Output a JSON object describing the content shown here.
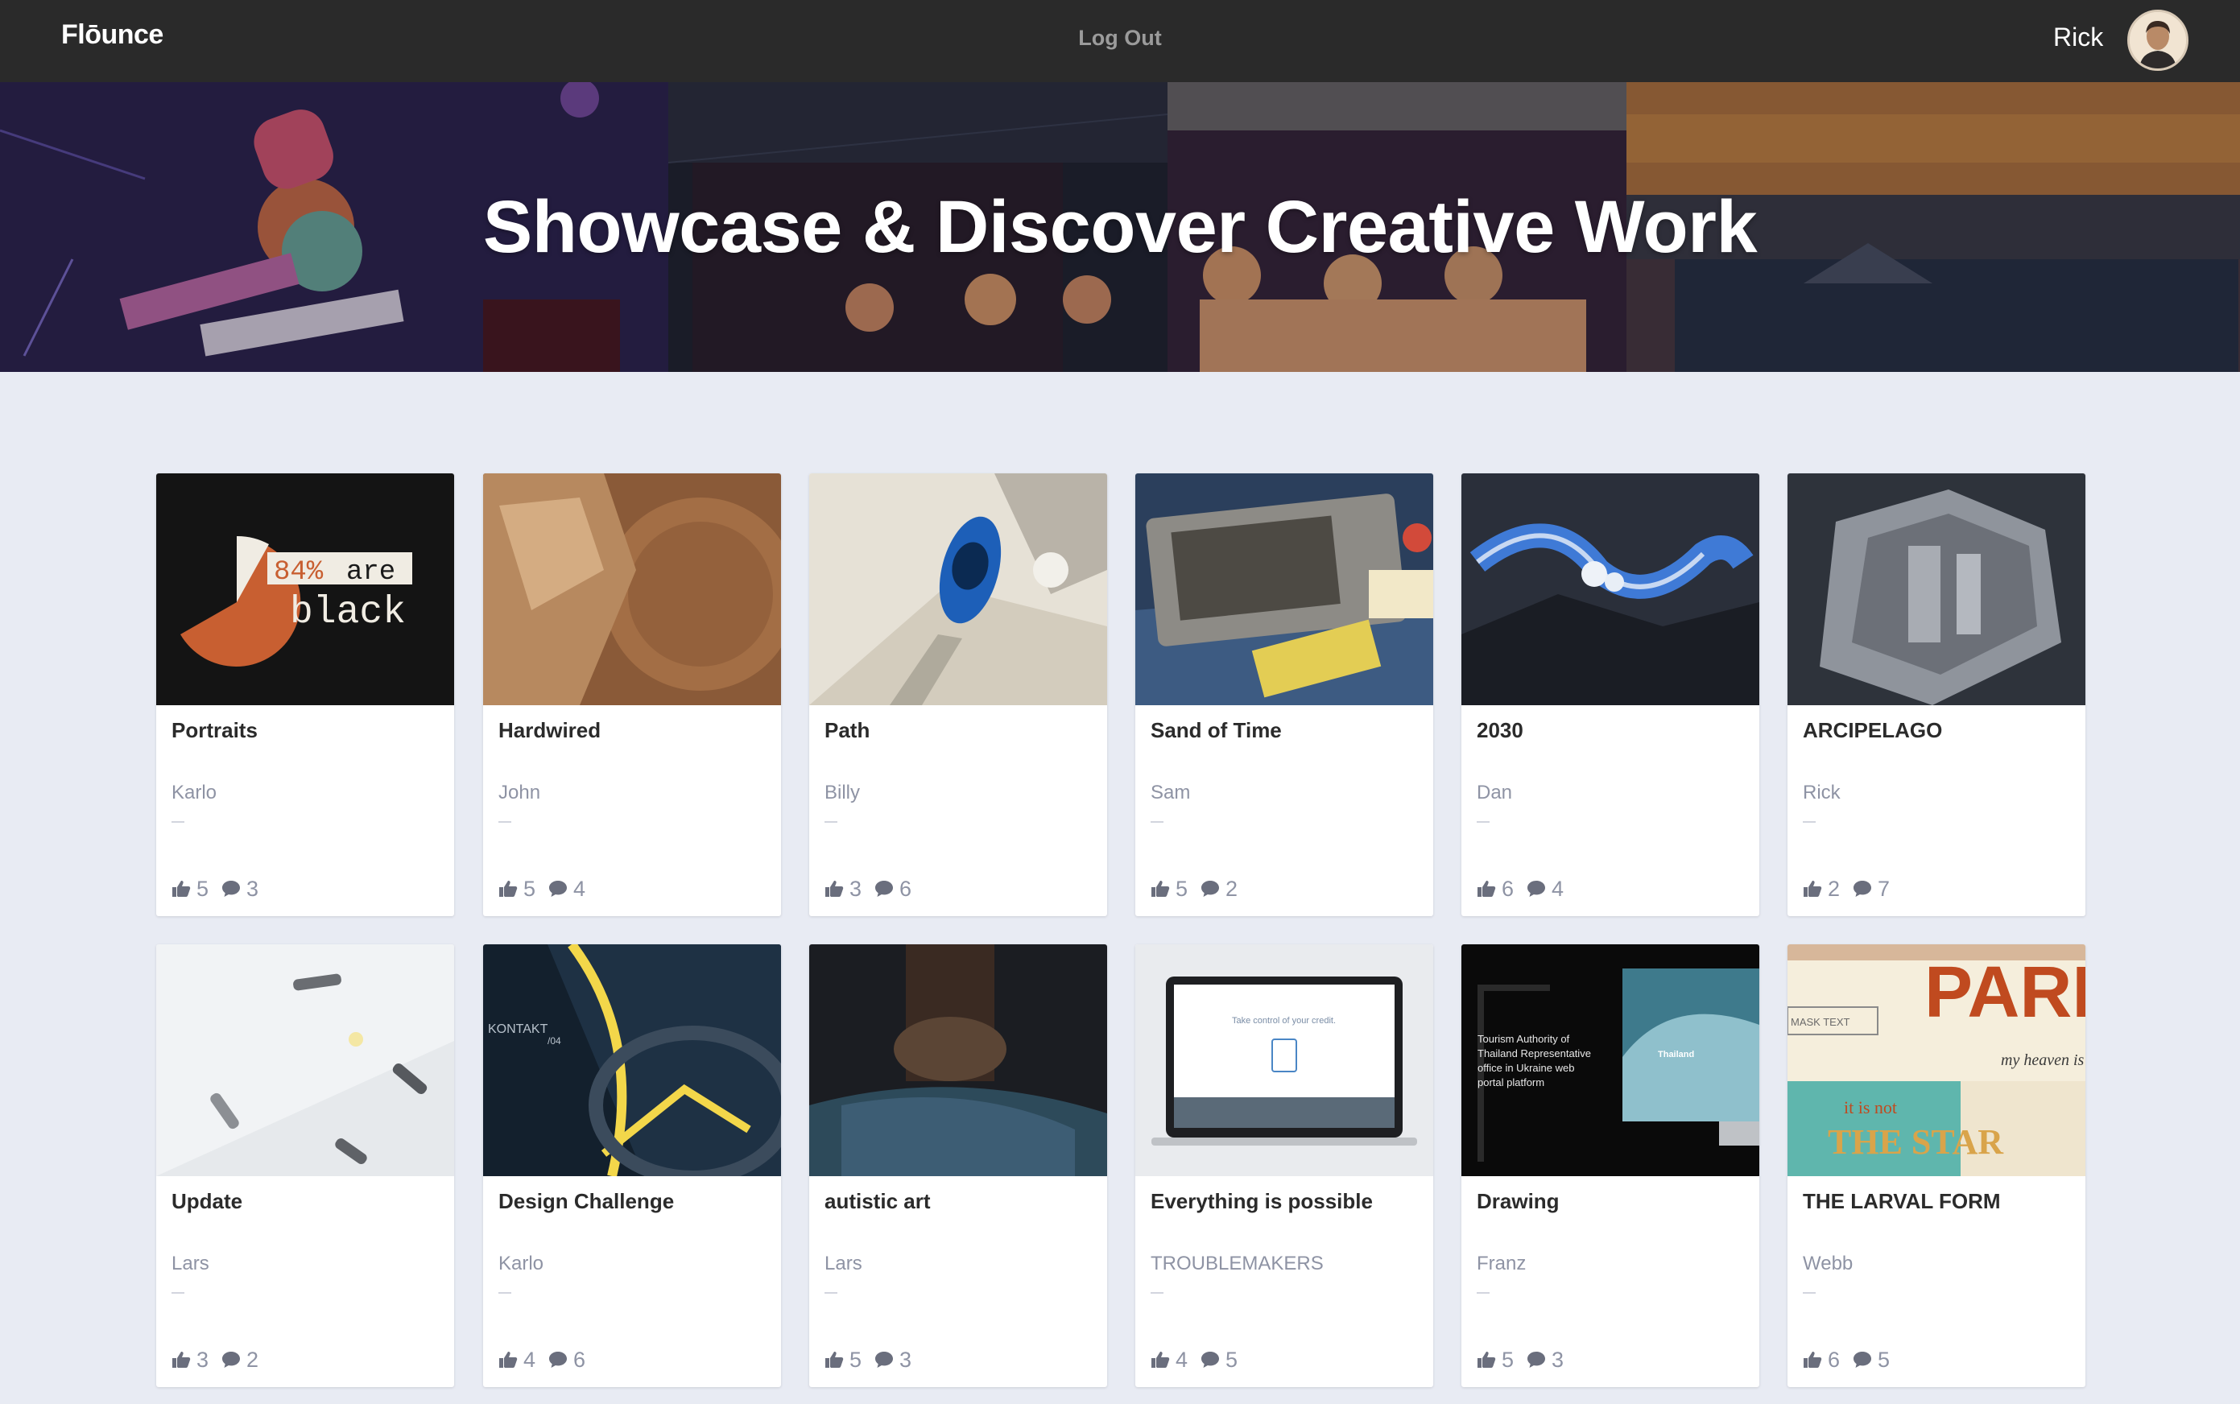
{
  "nav": {
    "logo": "Flōunce",
    "logout_label": "Log Out",
    "username": "Rick"
  },
  "hero": {
    "title": "Showcase & Discover Creative Work"
  },
  "colors": {
    "nav_bg": "#2a2a2a",
    "page_bg": "#e8ebf3",
    "card_bg": "#ffffff",
    "muted_text": "#8e93a4"
  },
  "projects": [
    {
      "title": "Portraits",
      "author": "Karlo",
      "likes": "5",
      "comments": "3",
      "thumb_text_1": "84%",
      "thumb_text_2": "are",
      "thumb_text_3": "black"
    },
    {
      "title": "Hardwired",
      "author": "John",
      "likes": "5",
      "comments": "4"
    },
    {
      "title": "Path",
      "author": "Billy",
      "likes": "3",
      "comments": "6"
    },
    {
      "title": "Sand of Time",
      "author": "Sam",
      "likes": "5",
      "comments": "2"
    },
    {
      "title": "2030",
      "author": "Dan",
      "likes": "6",
      "comments": "4"
    },
    {
      "title": "ARCIPELAGO",
      "author": "Rick",
      "likes": "2",
      "comments": "7"
    },
    {
      "title": "Update",
      "author": "Lars",
      "likes": "3",
      "comments": "2"
    },
    {
      "title": "Design Challenge",
      "author": "Karlo",
      "likes": "4",
      "comments": "6",
      "thumb_text_1": "KONTAKT",
      "thumb_text_2": "/04"
    },
    {
      "title": "autistic art",
      "author": "Lars",
      "likes": "5",
      "comments": "3"
    },
    {
      "title": "Everything is possible",
      "author": "TROUBLEMAKERS",
      "likes": "4",
      "comments": "5",
      "thumb_text_1": "Take control of your credit."
    },
    {
      "title": "Drawing",
      "author": "Franz",
      "likes": "5",
      "comments": "3",
      "thumb_text_1": "Tourism Authority of",
      "thumb_text_2": "Thailand Representative",
      "thumb_text_3": "office in Ukraine web",
      "thumb_text_4": "portal platform",
      "thumb_text_5": "Thailand"
    },
    {
      "title": "THE LARVAL FORM",
      "author": "Webb",
      "likes": "6",
      "comments": "5",
      "thumb_text_1": "PARIS",
      "thumb_text_2": "my heaven is",
      "thumb_text_3": "MASK TEXT",
      "thumb_text_4": "it is not",
      "thumb_text_5": "THE STAR"
    }
  ]
}
